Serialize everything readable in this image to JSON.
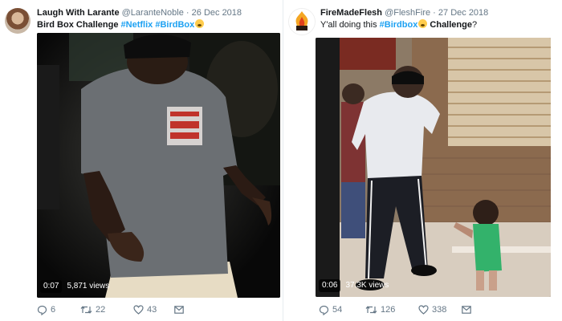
{
  "tweets": [
    {
      "author_name": "Laugh With Larante",
      "handle": "@LaranteNoble",
      "separator": "·",
      "date": "26 Dec 2018",
      "text": {
        "prefix": "Bird Box Challenge ",
        "hashtag1": "#Netflix",
        "hashtag2": "#BirdBox"
      },
      "video": {
        "duration": "0:07",
        "views": "5,871 views"
      },
      "actions": {
        "replies": "6",
        "retweets": "22",
        "likes": "43"
      }
    },
    {
      "author_name": "FireMadeFlesh",
      "handle": "@FleshFire",
      "separator": "·",
      "date": "27 Dec 2018",
      "text": {
        "prefix": "Y'all doing this ",
        "hashtag1": "#Birdbox",
        "suffix": " Challenge",
        "end": "?"
      },
      "video": {
        "duration": "0:06",
        "views": "37.3K views"
      },
      "actions": {
        "replies": "54",
        "retweets": "126",
        "likes": "338"
      }
    }
  ],
  "colors": {
    "link": "#1da1f2",
    "muted": "#657786",
    "text": "#14171a"
  },
  "icons": {
    "reply": "reply-icon",
    "retweet": "retweet-icon",
    "like": "heart-icon",
    "dm": "envelope-icon",
    "emoji": "grimacing-face-emoji"
  }
}
